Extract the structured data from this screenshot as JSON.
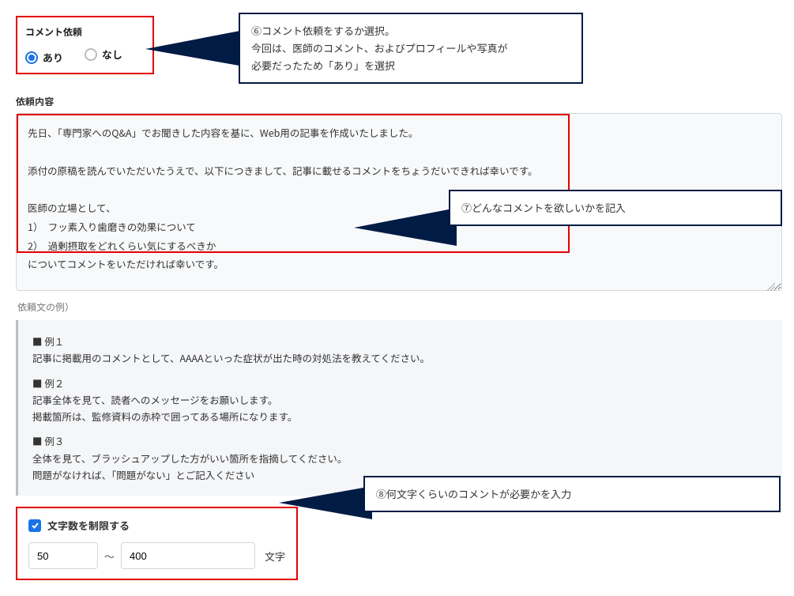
{
  "comment_request": {
    "label": "コメント依頼",
    "options": {
      "yes": "あり",
      "no": "なし"
    }
  },
  "callout6": {
    "line1": "⑥コメント依頼をするか選択。",
    "line2": "今回は、医師のコメント、およびプロフィールや写真が",
    "line3": "必要だったため「あり」を選択"
  },
  "request_content": {
    "label": "依頼内容",
    "text": "先日、「専門家へのQ&A」でお聞きした内容を基に、Web用の記事を作成いたしました。\n\n添付の原稿を読んでいただいたうえで、以下につきまして、記事に載せるコメントをちょうだいできれば幸いです。\n\n医師の立場として、\n1）　フッ素入り歯磨きの効果について\n2）　過剰摂取をどれくらい気にするべきか\nについてコメントをいただければ幸いです。"
  },
  "callout7": {
    "text": "⑦どんなコメントを欲しいかを記入"
  },
  "example_label": "依頼文の例）",
  "examples": {
    "ex1_title": "■ 例１",
    "ex1_body": "記事に掲載用のコメントとして、AAAAといった症状が出た時の対処法を教えてください。",
    "ex2_title": "■ 例２",
    "ex2_body1": "記事全体を見て、読者へのメッセージをお願いします。",
    "ex2_body2": "掲載箇所は、監修資料の赤枠で囲ってある場所になります。",
    "ex3_title": "■ 例３",
    "ex3_body1": "全体を見て、ブラッシュアップした方がいい箇所を指摘してください。",
    "ex3_body2": "問題がなければ、「問題がない」とご記入ください"
  },
  "char_limit": {
    "checkbox_label": "文字数を制限する",
    "min": "50",
    "sep": "～",
    "max": "400",
    "unit": "文字"
  },
  "callout8": {
    "text": "⑧何文字くらいのコメントが必要かを入力"
  }
}
